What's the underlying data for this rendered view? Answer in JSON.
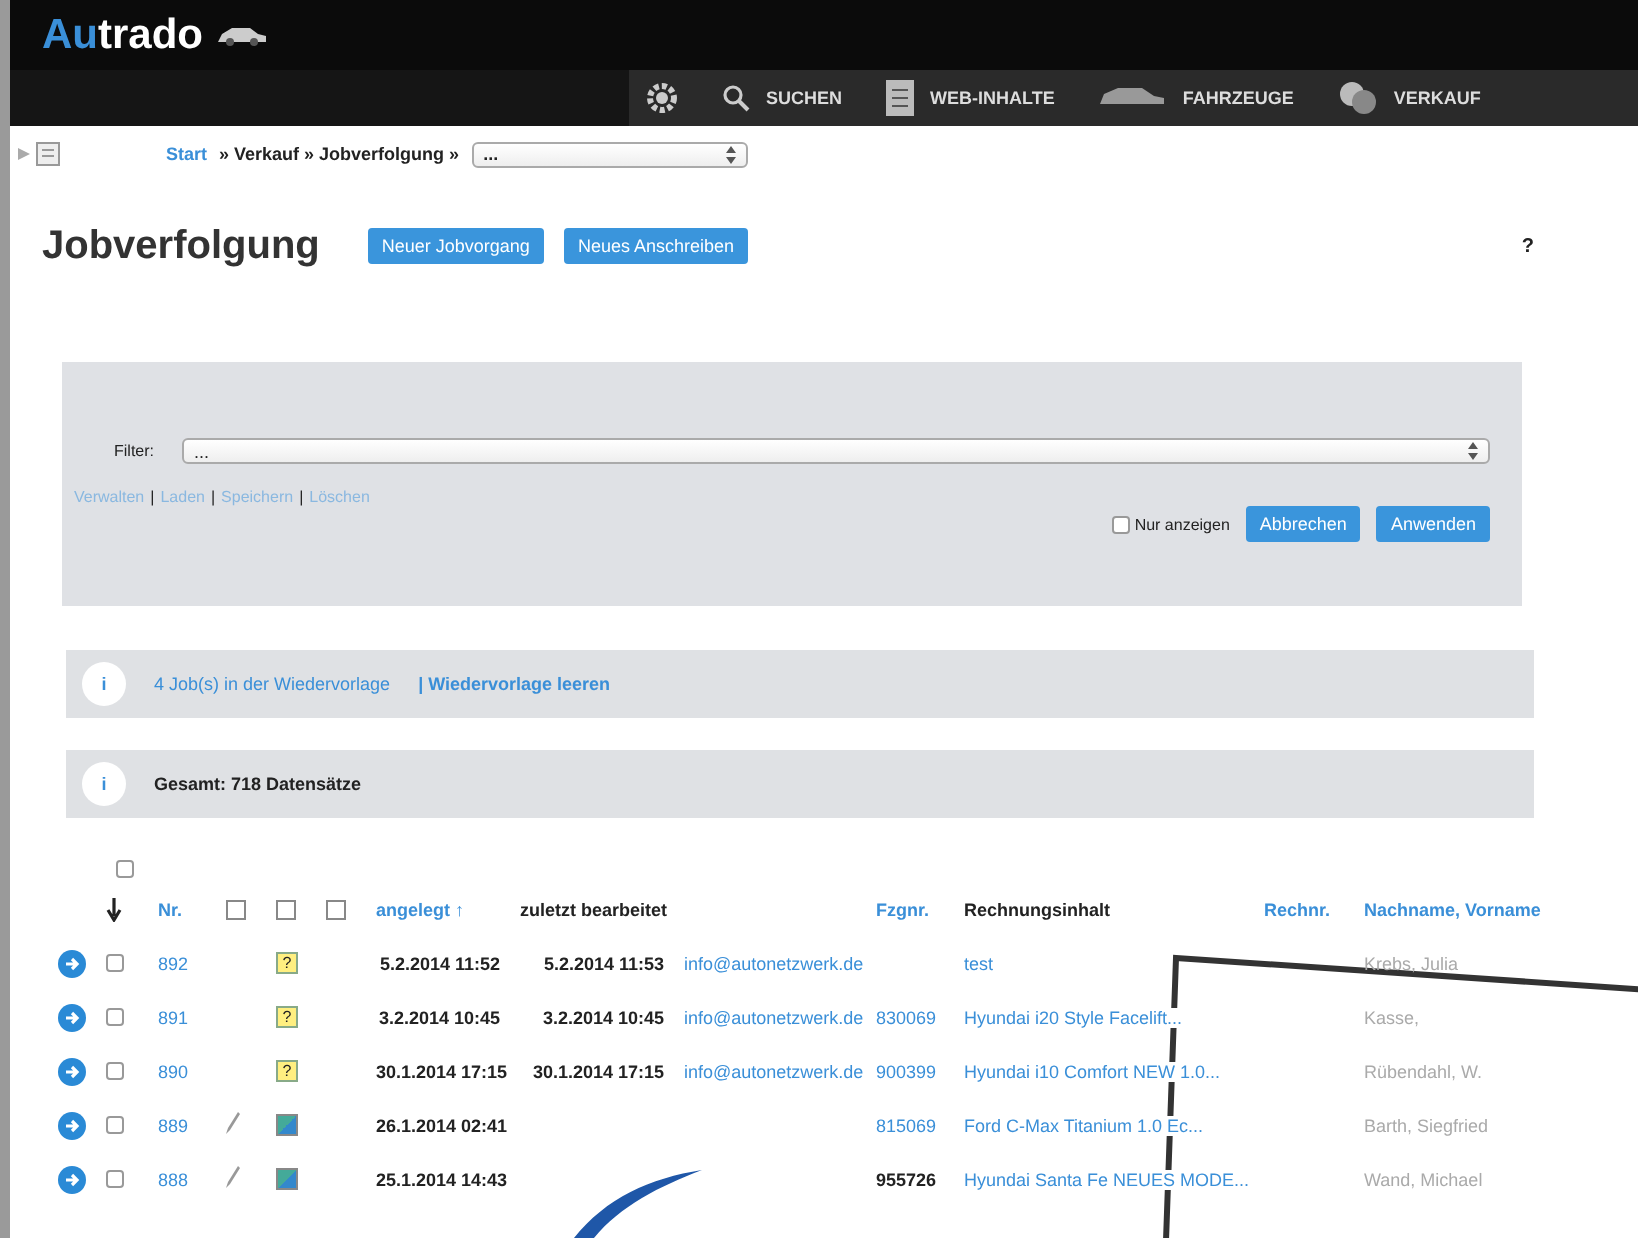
{
  "logo": {
    "accent": "Au",
    "rest": "trado"
  },
  "nav": [
    {
      "kind": "gear"
    },
    {
      "kind": "search",
      "label": "SUCHEN"
    },
    {
      "kind": "doc",
      "label": "WEB-INHALTE"
    },
    {
      "kind": "car",
      "label": "FAHRZEUGE"
    },
    {
      "kind": "coins",
      "label": "VERKAUF"
    }
  ],
  "breadcrumb": {
    "link": "Start",
    "path": "» Verkauf » Jobverfolgung »",
    "select": "..."
  },
  "title": "Jobverfolgung",
  "title_buttons": [
    "Neuer Jobvorgang",
    "Neues Anschreiben"
  ],
  "help": "?",
  "filter": {
    "label": "Filter:",
    "select": "...",
    "links": [
      "Verwalten",
      "Laden",
      "Speichern",
      "Löschen"
    ],
    "separator": "|",
    "only_show": {
      "label": "Nur anzeigen",
      "checked": false
    },
    "buttons": [
      "Abbrechen",
      "Anwenden"
    ]
  },
  "resubmission": {
    "icon": "i",
    "link": "4 Job(s) in der Wiedervorlage",
    "action": "| Wiedervorlage leeren"
  },
  "total": {
    "icon": "i",
    "text": "Gesamt: 718 Datensätze"
  },
  "table": {
    "select_all": {
      "checked": false
    },
    "columns": [
      {
        "label": "Nr.",
        "kind": "link"
      },
      {
        "label": "angelegt ↑",
        "kind": "link"
      },
      {
        "label": "zuletzt bearbeitet",
        "kind": "plain"
      },
      {
        "label": "Fzgnr.",
        "kind": "link"
      },
      {
        "label": "Rechnungsinhalt",
        "kind": "plain"
      },
      {
        "label": "Rechnr.",
        "kind": "link"
      },
      {
        "label": "Nachname, Vorname",
        "kind": "link"
      }
    ],
    "rows": [
      {
        "checked": false,
        "nr": "892",
        "pen": false,
        "kind": "question",
        "doc_text": "?",
        "created": "5.2.2014 11:52",
        "edited": "5.2.2014 11:53",
        "email": "info@autonetzwerk.de",
        "content": "test",
        "name": "Krebs, Julia"
      },
      {
        "checked": false,
        "nr": "891",
        "pen": false,
        "kind": "question",
        "doc_text": "?",
        "created": "3.2.2014 10:45",
        "edited": "3.2.2014 10:45",
        "email": "info@autonetzwerk.de",
        "vehicle": "830069",
        "vehicle_linked": true,
        "content": "Hyundai i20 Style Facelift...",
        "name": "Kasse,"
      },
      {
        "checked": false,
        "nr": "890",
        "pen": false,
        "kind": "question",
        "doc_text": "?",
        "created": "30.1.2014 17:15",
        "edited": "30.1.2014 17:15",
        "email": "info@autonetzwerk.de",
        "vehicle": "900399",
        "vehicle_linked": true,
        "content": "Hyundai i10 Comfort NEW 1.0...",
        "name": "Rübendahl, W."
      },
      {
        "checked": false,
        "nr": "889",
        "pen": true,
        "kind": "photo",
        "created": "26.1.2014 02:41",
        "vehicle": "815069",
        "vehicle_linked": true,
        "content": "Ford C-Max Titanium 1.0 Ec...",
        "name": "Barth, Siegfried"
      },
      {
        "checked": false,
        "nr": "888",
        "pen": true,
        "kind": "photo",
        "created": "25.1.2014 14:43",
        "vehicle": "955726",
        "vehicle_linked": false,
        "content": "Hyundai Santa Fe NEUES MODE...",
        "name": "Wand, Michael"
      }
    ]
  }
}
